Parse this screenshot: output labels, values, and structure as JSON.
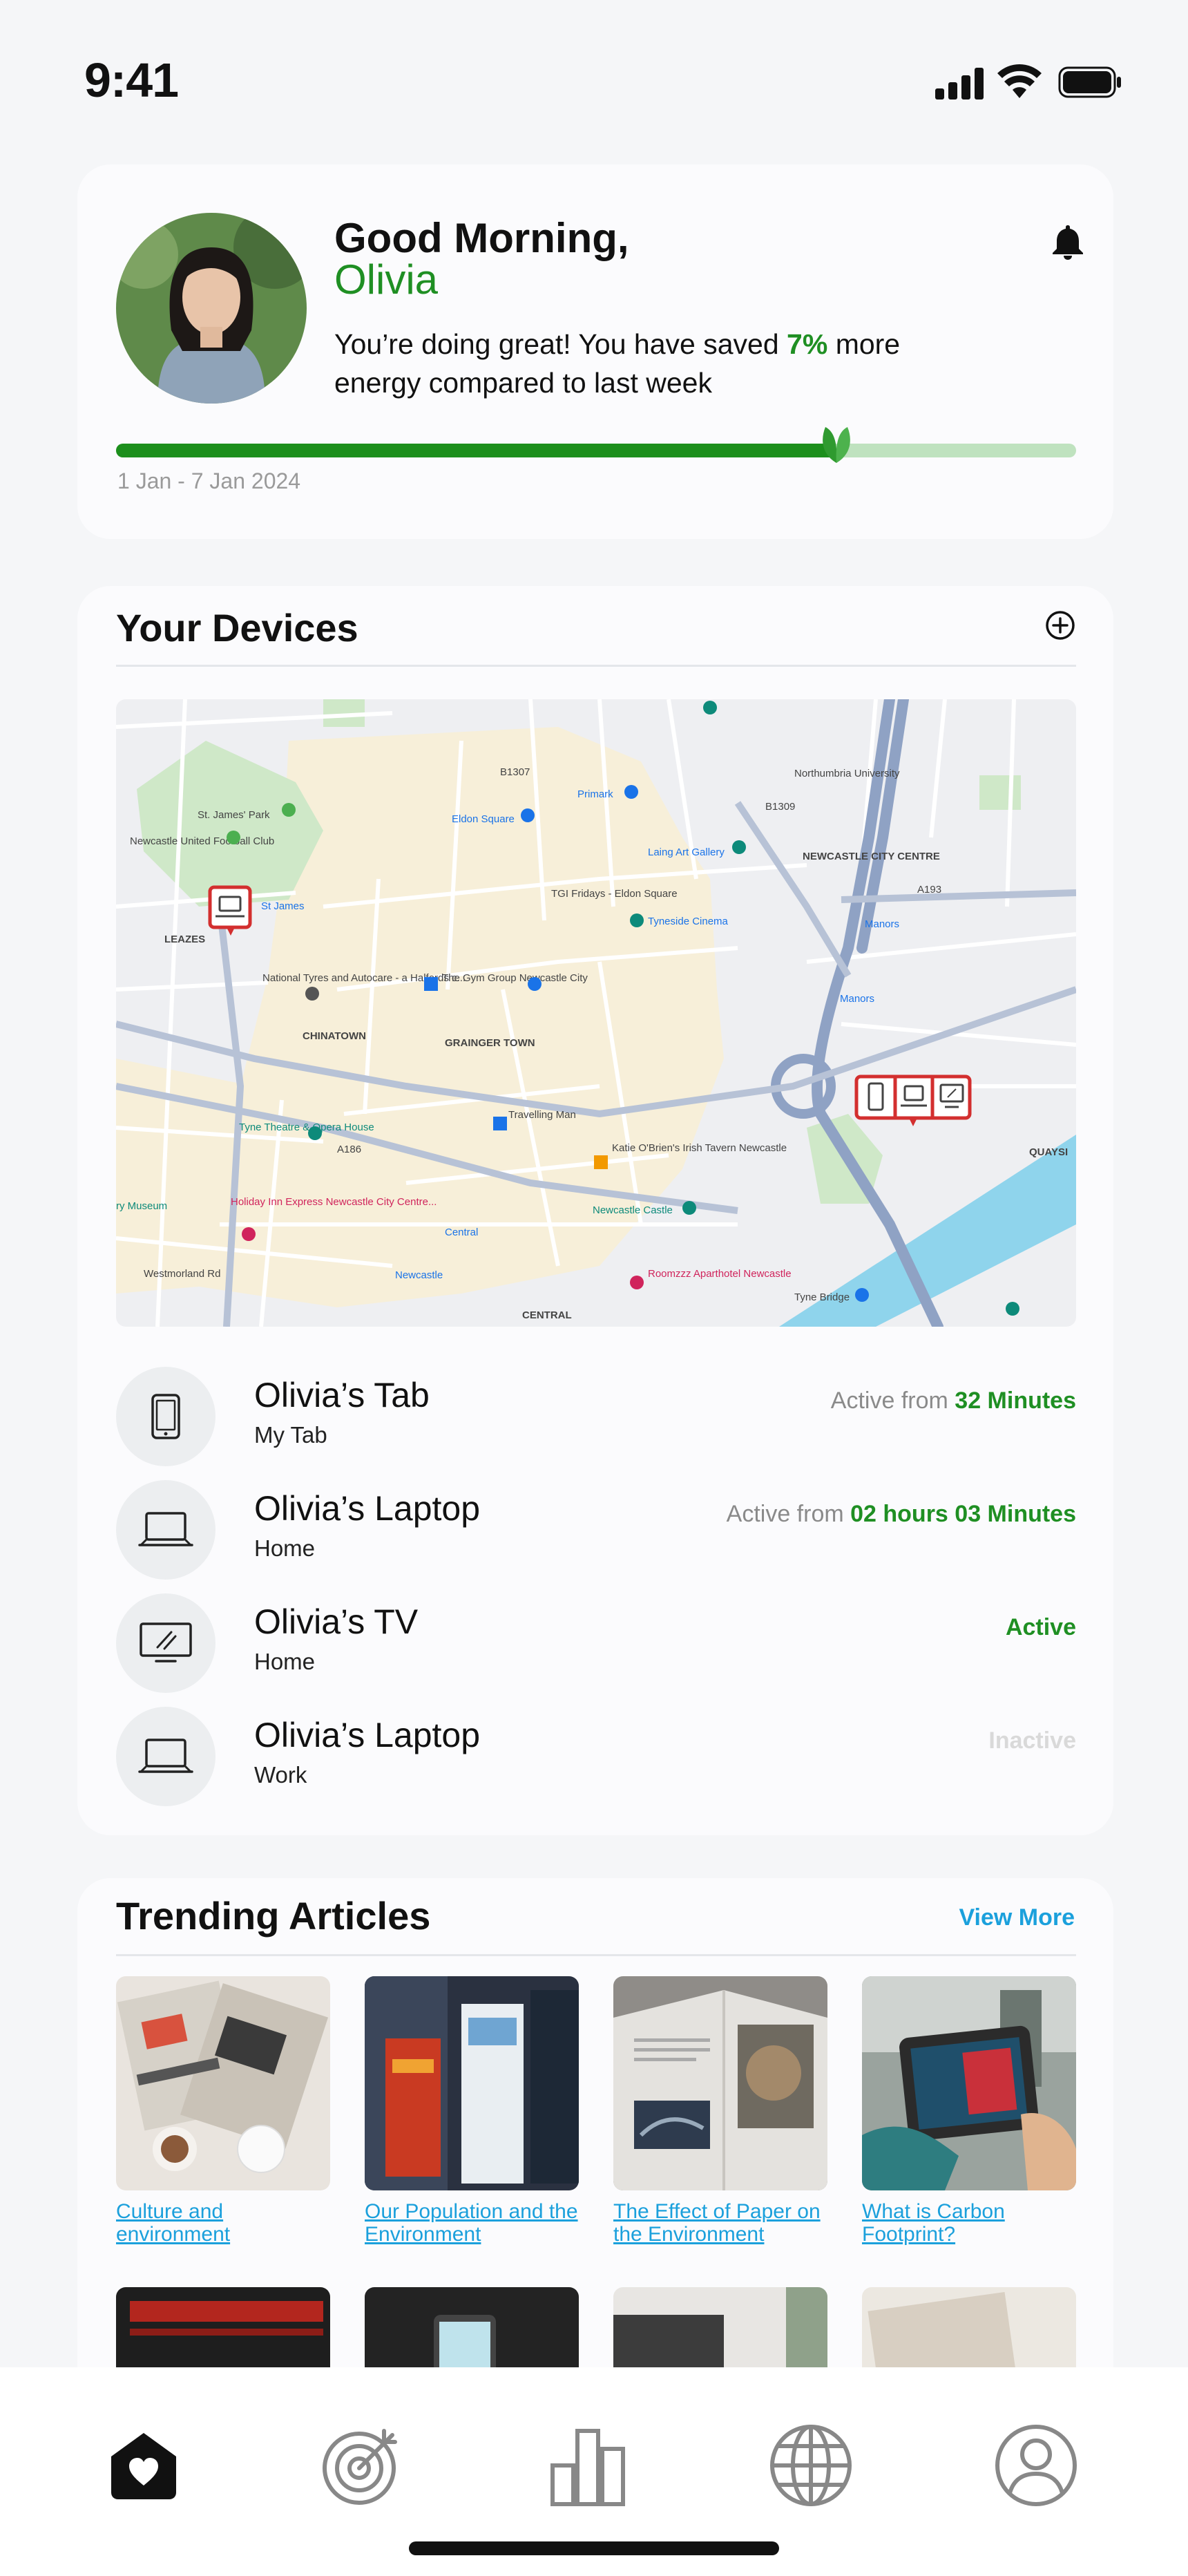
{
  "status_bar": {
    "time": "9:41"
  },
  "greeting": {
    "line1": "Good Morning,",
    "name": "Olivia",
    "saved_prefix": "You’re doing great! You have saved ",
    "saved_percent": "7%",
    "saved_suffix": " more energy compared to last week",
    "progress_fraction": 0.75,
    "date_range": "1 Jan - 7 Jan 2024"
  },
  "devices": {
    "title": "Your Devices",
    "map_labels": {
      "st_james_park": "St. James' Park",
      "football_club": "Newcastle United Football Club",
      "eldon_square": "Eldon Square",
      "primark": "Primark",
      "northumbria": "Northumbria University",
      "laing": "Laing Art Gallery",
      "city_centre": "NEWCASTLE CITY CENTRE",
      "tgi": "TGI Fridays - Eldon Square",
      "tyneside": "Tyneside Cinema",
      "leazes": "LEAZES",
      "st_james_m": "St James",
      "manors": "Manors",
      "manors2": "Manors",
      "national_tyres": "National Tyres and Autocare - a Halfords c...",
      "gym": "The Gym Group Newcastle City",
      "chinatown": "CHINATOWN",
      "grainger": "GRAINGER TOWN",
      "travelling_man": "Travelling Man",
      "katie": "Katie O'Brien's Irish Tavern Newcastle",
      "tyne_theatre": "Tyne Theatre & Opera House",
      "museum": "ry Museum",
      "holiday_inn": "Holiday Inn Express Newcastle City Centre...",
      "central_m": "Central",
      "castle": "Newcastle Castle",
      "newcastle_station": "Newcastle",
      "roomzzz": "Roomzzz Aparthotel Newcastle",
      "tyne_bridge": "Tyne Bridge",
      "central": "CENTRAL",
      "quays": "QUAYSI",
      "westmorland": "Westmorland Rd",
      "a186": "A186",
      "a193": "A193",
      "b1309": "B1309",
      "b1307": "B1307"
    },
    "items": [
      {
        "name": "Olivia’s Tab",
        "location": "My Tab",
        "status_prefix": "Active from ",
        "status_value": "32 Minutes",
        "icon": "tablet-icon"
      },
      {
        "name": "Olivia’s Laptop",
        "location": "Home",
        "status_prefix": "Active from ",
        "status_value": "02 hours 03 Minutes",
        "icon": "laptop-icon"
      },
      {
        "name": "Olivia’s TV",
        "location": "Home",
        "status_value": "Active",
        "icon": "tv-icon"
      },
      {
        "name": "Olivia’s Laptop",
        "location": "Work",
        "status_value": "Inactive",
        "icon": "laptop-icon"
      }
    ]
  },
  "articles": {
    "title": "Trending Articles",
    "view_more": "View More",
    "items": [
      {
        "title": "Culture and environment"
      },
      {
        "title": "Our Population and the Environment"
      },
      {
        "title": "The Effect of Paper on the Environment"
      },
      {
        "title": "What is Carbon Footprint?"
      }
    ]
  },
  "tab_bar": {
    "tabs": [
      "home-icon",
      "target-icon",
      "stats-icon",
      "globe-icon",
      "profile-icon"
    ],
    "active": "home-icon"
  },
  "colors": {
    "accent": "#1f8f23",
    "link": "#1ba0dc",
    "progress_track": "#bfe2bf"
  }
}
